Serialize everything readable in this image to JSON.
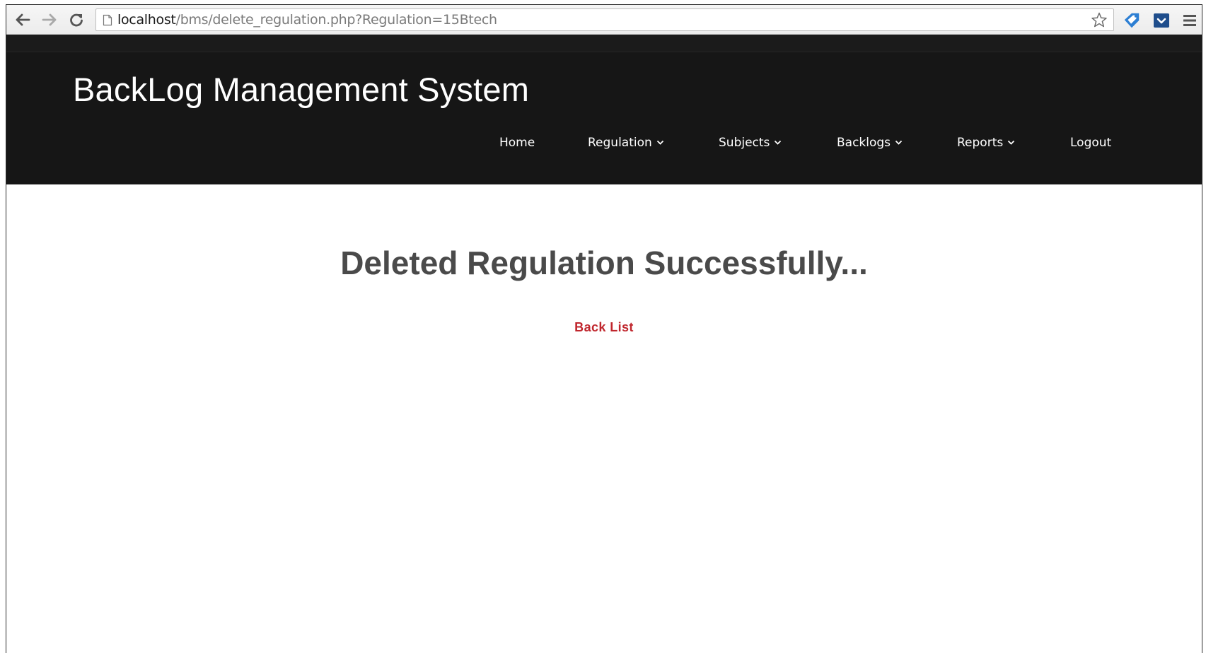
{
  "browser": {
    "url_host": "localhost",
    "url_path": "/bms/delete_regulation.php?Regulation=15Btech",
    "icons": [
      "back-arrow-icon",
      "forward-arrow-icon",
      "reload-icon",
      "page-icon",
      "star-icon",
      "tag-extension-icon",
      "pocket-extension-icon",
      "hamburger-menu-icon"
    ]
  },
  "header": {
    "site_title": "BackLog Management System",
    "nav": [
      {
        "label": "Home",
        "dropdown": false
      },
      {
        "label": "Regulation",
        "dropdown": true
      },
      {
        "label": "Subjects",
        "dropdown": true
      },
      {
        "label": "Backlogs",
        "dropdown": true
      },
      {
        "label": "Reports",
        "dropdown": true
      },
      {
        "label": "Logout",
        "dropdown": false
      }
    ]
  },
  "content": {
    "message": "Deleted Regulation Successfully...",
    "back_link": "Back List"
  },
  "colors": {
    "header_bg": "#161616",
    "message_text": "#4a4a4a",
    "link": "#c0262d"
  }
}
